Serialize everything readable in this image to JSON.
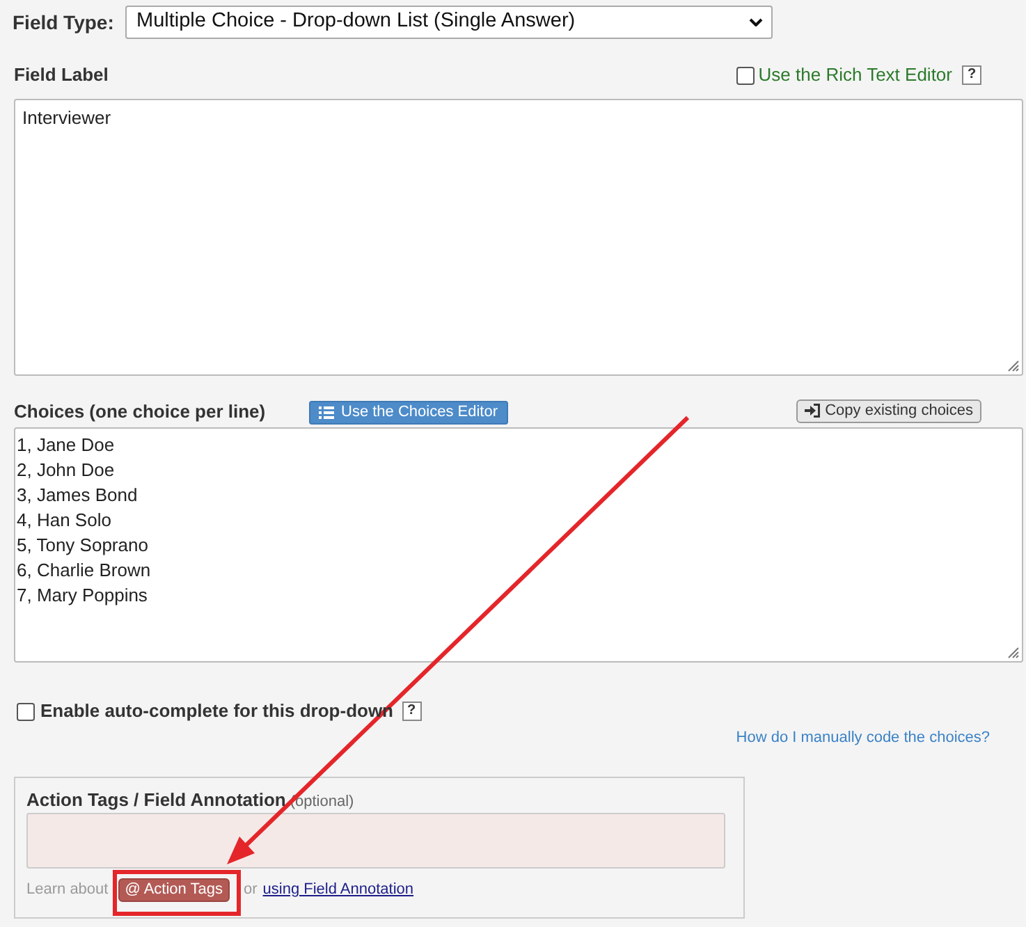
{
  "field_type": {
    "label": "Field Type:",
    "value": "Multiple Choice - Drop-down List (Single Answer)"
  },
  "field_label": {
    "label": "Field Label",
    "rich_text_editor": {
      "label": "Use the Rich Text Editor",
      "checked": false,
      "help": "?"
    },
    "value": "Interviewer"
  },
  "choices": {
    "label": "Choices (one choice per line)",
    "editor_button": "Use the Choices Editor",
    "copy_button": "Copy existing choices",
    "lines": [
      "1, Jane Doe",
      "2, John Doe",
      "3, James Bond",
      "4, Han Solo",
      "5, Tony Soprano",
      "6, Charlie Brown",
      "7, Mary Poppins"
    ]
  },
  "auto_complete": {
    "label": "Enable auto-complete for this drop-down",
    "checked": false,
    "help": "?"
  },
  "help_link": "How do I manually code the choices?",
  "action_tags": {
    "title": "Action Tags / Field Annotation",
    "note": "(optional)",
    "learn_prefix": "Learn about",
    "tags_button": "@ Action Tags",
    "conjunction": "or",
    "annotation_link": "using Field Annotation"
  }
}
